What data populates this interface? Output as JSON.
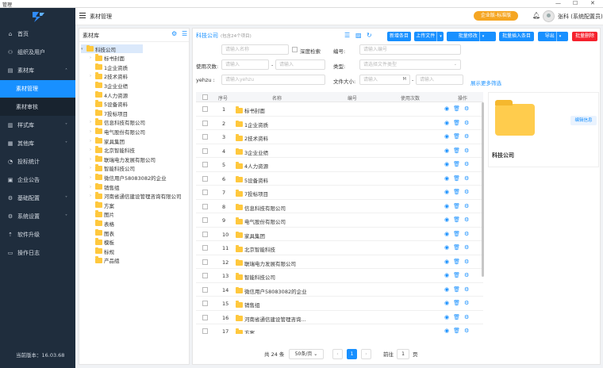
{
  "window": {
    "title": "管理",
    "controls": [
      "—",
      "☐",
      "✕"
    ]
  },
  "sidebar": {
    "version": "当前版本：16.03.68",
    "items": [
      {
        "icon": "home-icon",
        "glyph": "⌂",
        "label": "首页"
      },
      {
        "icon": "org-icon",
        "glyph": "⚇",
        "label": "组织及用户"
      },
      {
        "icon": "library-icon",
        "glyph": "▤",
        "label": "素材库",
        "chev": "˄"
      },
      {
        "sub": true,
        "label": "素材管理",
        "active": true
      },
      {
        "sub": true,
        "label": "素材审核"
      },
      {
        "icon": "style-icon",
        "glyph": "▥",
        "label": "样式库",
        "chev": "˅"
      },
      {
        "icon": "other-icon",
        "glyph": "▦",
        "label": "其他库",
        "chev": "˅"
      },
      {
        "icon": "stats-icon",
        "glyph": "◔",
        "label": "投标统计"
      },
      {
        "icon": "notice-icon",
        "glyph": "▣",
        "label": "企业公告"
      },
      {
        "icon": "config-icon",
        "glyph": "⚙",
        "label": "基础配置",
        "chev": "˅"
      },
      {
        "icon": "settings-icon",
        "glyph": "⚙",
        "label": "系统设置",
        "chev": "˅"
      },
      {
        "icon": "upgrade-icon",
        "glyph": "⇡",
        "label": "软件升级"
      },
      {
        "icon": "log-icon",
        "glyph": "▭",
        "label": "操作日志"
      }
    ]
  },
  "topbar": {
    "title": "素材管理",
    "edition": "企业版-标准版",
    "user": "张科 (系统配置员)"
  },
  "tree": {
    "header": "素材库",
    "nodes": [
      {
        "label": "科技公司",
        "level": 0,
        "arrow": "▾",
        "sel": true
      },
      {
        "label": "标书封面",
        "level": 1,
        "arrow": "›"
      },
      {
        "label": "1企业资质",
        "level": 1,
        "arrow": ""
      },
      {
        "label": "2技术资料",
        "level": 1,
        "arrow": "›"
      },
      {
        "label": "3企业业绩",
        "level": 1,
        "arrow": ""
      },
      {
        "label": "4人力资源",
        "level": 1,
        "arrow": ""
      },
      {
        "label": "5设备资料",
        "level": 1,
        "arrow": ""
      },
      {
        "label": "7投标项目",
        "level": 1,
        "arrow": ""
      },
      {
        "label": "信息科技有限公司",
        "level": 1,
        "arrow": "›"
      },
      {
        "label": "电气股份有限公司",
        "level": 1,
        "arrow": "›"
      },
      {
        "label": "家具集团",
        "level": 1,
        "arrow": "›"
      },
      {
        "label": "北京智能科技",
        "level": 1,
        "arrow": "›"
      },
      {
        "label": "联瑞电力发展有限公司",
        "level": 1,
        "arrow": "›"
      },
      {
        "label": "智能科技公司",
        "level": 1,
        "arrow": "›"
      },
      {
        "label": "微信用户58083082的企业",
        "level": 1,
        "arrow": "›"
      },
      {
        "label": "销售组",
        "level": 1,
        "arrow": "›"
      },
      {
        "label": "河南省通信建设管理咨询有限公司",
        "level": 1,
        "arrow": "›"
      },
      {
        "label": "方案",
        "level": 1,
        "arrow": ""
      },
      {
        "label": "图片",
        "level": 1,
        "arrow": ""
      },
      {
        "label": "表格",
        "level": 1,
        "arrow": ""
      },
      {
        "label": "图表",
        "level": 1,
        "arrow": ""
      },
      {
        "label": "模板",
        "level": 1,
        "arrow": ""
      },
      {
        "label": "标规",
        "level": 1,
        "arrow": ""
      },
      {
        "label": "产品组",
        "level": 1,
        "arrow": ""
      }
    ]
  },
  "main": {
    "breadcrumb": "科技公司",
    "breadcrumb_sub": "(包含24个项目)",
    "buttons": [
      {
        "label": "新增条目",
        "dd": false
      },
      {
        "label": "上传文件",
        "dd": true
      },
      {
        "label": "批量修改",
        "dd": true
      },
      {
        "label": "批量插入条目",
        "dd": false
      },
      {
        "label": "导出",
        "dd": true
      },
      {
        "label": "批量删除",
        "dd": false,
        "red": true
      }
    ],
    "filters": {
      "name_ph": "请输入名称",
      "exact": "深度检索",
      "code_label": "编号:",
      "code_ph": "请输入编号",
      "usage_label": "使用次数:",
      "usage_ph1": "请输入",
      "usage_sep": "-",
      "usage_ph2": "请输入",
      "type_label": "类型:",
      "type_ph": "请选择文件类型",
      "yehzu_label": "yehzu :",
      "yehzu_ph": "请输入yehzu",
      "size_label": "文件大小:",
      "size_ph1": "请输入",
      "size_unit": "M",
      "size_sep": "-",
      "size_ph2": "请输入",
      "more": "展示更多筛选"
    },
    "table": {
      "headers": {
        "seq": "序号",
        "name": "名称",
        "code": "编号",
        "usage": "使用次数",
        "ops": "操作"
      },
      "rows": [
        "标书封面",
        "1企业资质",
        "2技术资料",
        "3企业业绩",
        "4人力资源",
        "5设备资料",
        "7投标项目",
        "信息科技有限公司",
        "电气股份有限公司",
        "家具集团",
        "北京智能科技",
        "联瑞电力发展有限公司",
        "智能科技公司",
        "微信用户58083082的企业",
        "销售组",
        "河南省通信建设管理咨询...",
        "方案"
      ]
    },
    "card": {
      "name": "科技公司",
      "edit": "编辑信息"
    },
    "pager": {
      "total": "共 24 条",
      "size": "50条/页",
      "prev": "‹",
      "page": "1",
      "next": "›",
      "goto": "前往",
      "goto_val": "1",
      "page_unit": "页"
    }
  }
}
